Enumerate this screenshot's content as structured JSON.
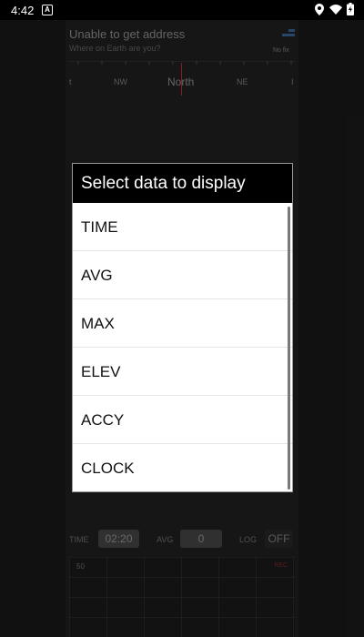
{
  "status_bar": {
    "time": "4:42",
    "notification_glyph": "A",
    "icons": [
      "location-icon",
      "wifi-icon",
      "battery-icon"
    ]
  },
  "app": {
    "address_title": "Unable to get address",
    "address_subtitle": "Where on Earth are you?",
    "fix_status": "No fix",
    "compass_labels": {
      "left": "t",
      "nw": "NW",
      "north": "North",
      "ne": "NE",
      "right": "I"
    },
    "stats": {
      "time_label": "TIME",
      "time_value": "02:20",
      "avg_label": "AVG",
      "avg_value": "0",
      "log_label": "LOG",
      "log_value": "OFF"
    },
    "graph": {
      "y_max": "50",
      "rec_label": "REC"
    }
  },
  "dialog": {
    "title": "Select data to display",
    "items": [
      "TIME",
      "AVG",
      "MAX",
      "ELEV",
      "ACCY",
      "CLOCK"
    ]
  },
  "colors": {
    "needle": "#c0392b",
    "dialog_header": "#000000",
    "dialog_body": "#ffffff"
  }
}
